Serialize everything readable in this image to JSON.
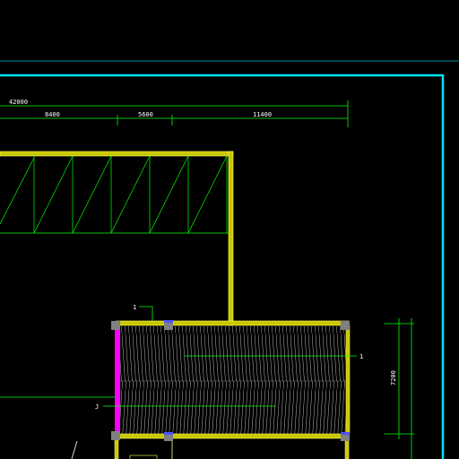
{
  "drawing": {
    "background": "#000000",
    "colors": {
      "frame": "#00e5ff",
      "dimension": "#00ff00",
      "wall": "#ffff66",
      "wall_fill": "#c8c800",
      "column": "#808080",
      "column_top": "#5050ff",
      "hatch": "#c0c0c0",
      "highlight_edge": "#ff00ff",
      "text": "#ffffff"
    },
    "dimensions": {
      "overall": "42000",
      "segments": [
        "8400",
        "5600",
        "11400"
      ],
      "vertical": "7200"
    },
    "tags": {
      "upper": "1",
      "right": "1",
      "lower": "J"
    }
  }
}
